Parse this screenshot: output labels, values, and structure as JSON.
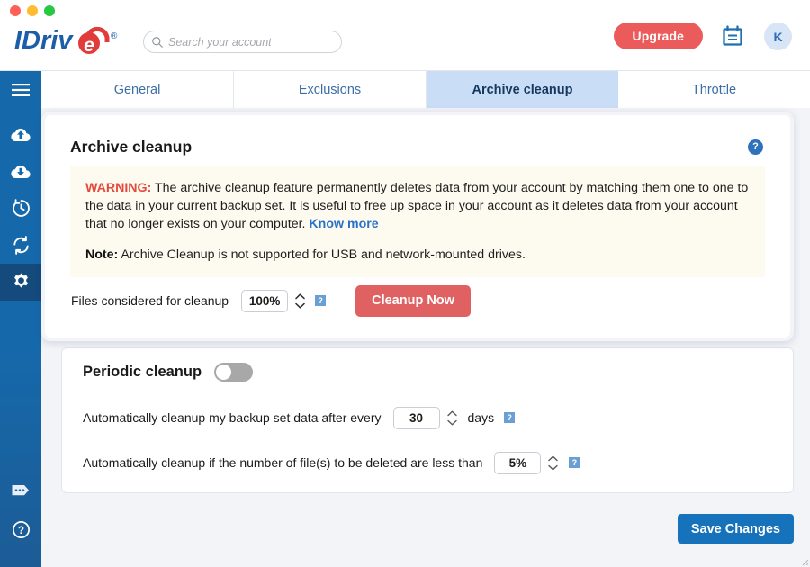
{
  "window": {
    "traffic_lights": [
      "close",
      "minimize",
      "zoom"
    ]
  },
  "header": {
    "logo_text": "IDrive",
    "logo_mark": "e",
    "logo_trademark": "®",
    "search": {
      "placeholder": "Search your account",
      "value": "",
      "icon": "search-icon"
    },
    "upgrade_label": "Upgrade",
    "calendar_icon": "calendar-icon",
    "avatar_initial": "K"
  },
  "sidebar": {
    "items": [
      {
        "name": "menu",
        "icon": "hamburger-menu-icon",
        "active": false
      },
      {
        "name": "backup",
        "icon": "cloud-upload-icon",
        "active": false
      },
      {
        "name": "restore",
        "icon": "cloud-download-icon",
        "active": false
      },
      {
        "name": "scheduler",
        "icon": "clock-history-icon",
        "active": false
      },
      {
        "name": "sync",
        "icon": "sync-refresh-icon",
        "active": false
      },
      {
        "name": "settings",
        "icon": "gear-icon",
        "active": true
      }
    ],
    "bottom_items": [
      {
        "name": "chat",
        "icon": "chat-tag-icon"
      },
      {
        "name": "help",
        "icon": "question-circle-icon"
      }
    ]
  },
  "tabs": [
    {
      "label": "General",
      "active": false
    },
    {
      "label": "Exclusions",
      "active": false
    },
    {
      "label": "Archive cleanup",
      "active": true
    },
    {
      "label": "Throttle",
      "active": false
    }
  ],
  "archive_card": {
    "title": "Archive cleanup",
    "help_icon_glyph": "?",
    "warning": {
      "label": "WARNING:",
      "text": " The archive cleanup feature permanently deletes data from your account by matching them one to one to the data in your current backup set. It is useful to free up space in your account as it deletes data from your account that no longer exists on your computer. ",
      "link_label": "Know more",
      "note_label": "Note:",
      "note_text": " Archive Cleanup is not supported for USB and network-mounted drives."
    },
    "files_label": "Files considered for cleanup",
    "files_value": "100%",
    "files_hint_glyph": "?",
    "cleanup_button_label": "Cleanup Now"
  },
  "periodic_card": {
    "title": "Periodic cleanup",
    "toggle_state": "off",
    "row1": {
      "label": "Automatically cleanup my backup set data after every",
      "value": "30",
      "unit": "days",
      "hint_glyph": "?"
    },
    "row2": {
      "label": "Automatically cleanup if the number of file(s) to be deleted are less than",
      "value": "5%",
      "hint_glyph": "?"
    }
  },
  "footer": {
    "save_label": "Save Changes"
  },
  "colors": {
    "accent_blue": "#1673bb",
    "sidebar_blue": "#1569ab",
    "sidebar_active": "#144a7c",
    "tab_active_bg": "#c9ddf7",
    "danger_red": "#e06161",
    "upgrade_red": "#ec5b5b",
    "warning_bg": "#fdfbef",
    "warning_text": "#e4493f",
    "link_blue": "#2a72c8",
    "page_bg": "#f2f4f8"
  }
}
